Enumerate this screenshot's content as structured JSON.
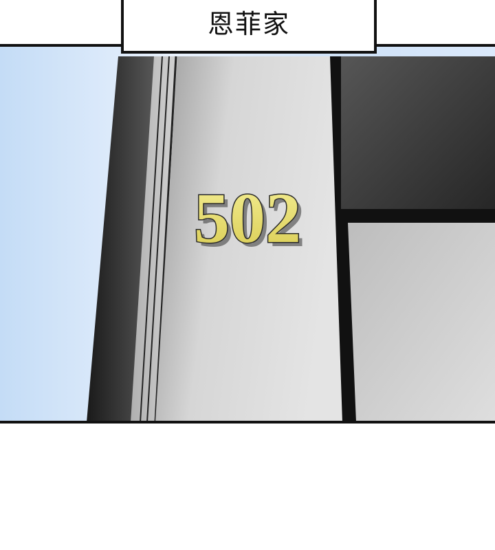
{
  "caption": {
    "text": "恩菲家"
  },
  "door_sign": {
    "number": "502",
    "color": "#e9df72"
  },
  "palette": {
    "sky_light": "#f4f8ff",
    "sky_blue": "#c4dcf6",
    "door_light": "#dcdcdc",
    "door_dark": "#9a9a9a",
    "outline": "#111111"
  }
}
